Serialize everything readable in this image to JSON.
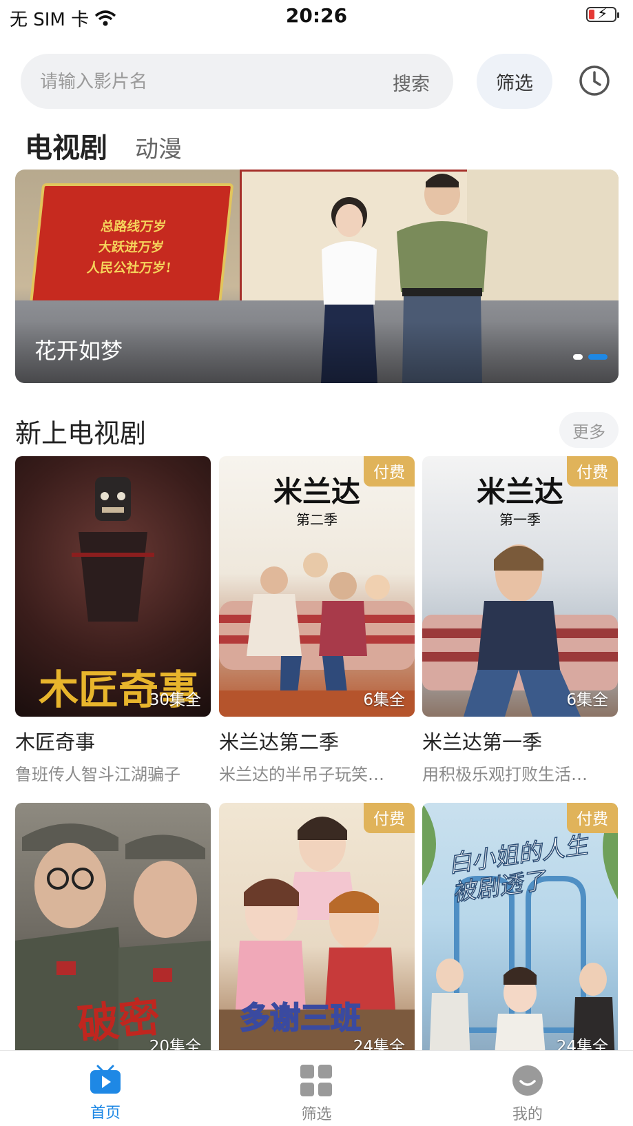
{
  "status_bar": {
    "carrier": "无 SIM 卡",
    "time": "20:26"
  },
  "search": {
    "placeholder": "请输入影片名",
    "button": "搜索"
  },
  "filter_button": "筛选",
  "tabs": [
    {
      "label": "电视剧",
      "active": true
    },
    {
      "label": "动漫",
      "active": false
    }
  ],
  "banner": {
    "title": "花开如梦",
    "poster_lines": [
      "总路线万岁",
      "大跃进万岁",
      "人民公社万岁!"
    ],
    "page_count": 2,
    "active_page": 2
  },
  "section": {
    "title": "新上电视剧",
    "more": "更多"
  },
  "shows": [
    {
      "name": "木匠奇事",
      "desc": "鲁班传人智斗江湖骗子",
      "episodes": "30集全",
      "paid": false,
      "art_text": "木匠奇事"
    },
    {
      "name": "米兰达第二季",
      "desc": "米兰达的半吊子玩笑…",
      "episodes": "6集全",
      "paid": true,
      "badge": "付费",
      "art_title": "米兰达",
      "art_sub": "第二季"
    },
    {
      "name": "米兰达第一季",
      "desc": "用积极乐观打败生活…",
      "episodes": "6集全",
      "paid": true,
      "badge": "付费",
      "art_title": "米兰达",
      "art_sub": "第一季"
    },
    {
      "name": "破密",
      "episodes": "20集全",
      "paid": false,
      "art_text": "破密"
    },
    {
      "name": "多谢三班",
      "episodes": "24集全",
      "paid": true,
      "badge": "付费",
      "art_text": "多谢三班"
    },
    {
      "name": "白小姐的人生被剧透了",
      "episodes": "24集全",
      "paid": true,
      "badge": "付费",
      "art_text": "白小姐的人生被剧透了"
    }
  ],
  "bottom_nav": [
    {
      "label": "首页",
      "icon": "tv-play-icon",
      "active": true
    },
    {
      "label": "筛选",
      "icon": "grid-icon",
      "active": false
    },
    {
      "label": "我的",
      "icon": "smile-face-icon",
      "active": false
    }
  ],
  "colors": {
    "accent": "#1e88e5",
    "badge": "#e0b35a",
    "search_bg": "#f0f1f3"
  }
}
